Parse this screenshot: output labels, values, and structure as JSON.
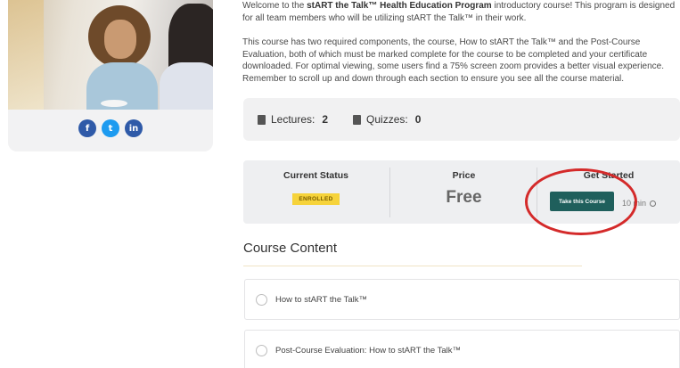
{
  "intro": {
    "p1_prefix": "Welcome to the ",
    "p1_bold": "stART the Talk™ Health Education Program",
    "p1_suffix": " introductory course! This program is designed for all team members who will be utilizing stART the Talk™ in their work.",
    "p2": "This course has two required components, the course, How to stART the Talk™ and the Post-Course Evaluation, both of which must be marked complete for the course to be completed and your certificate downloaded. For optimal viewing, some users find a 75% screen zoom provides a better visual experience. Remember to scroll up and down through each section to ensure you see all the course material."
  },
  "socials": [
    {
      "name": "facebook-icon",
      "glyph": "f"
    },
    {
      "name": "twitter-icon",
      "glyph": "t"
    },
    {
      "name": "linkedin-icon",
      "glyph": "in"
    }
  ],
  "stats": {
    "lectures_label": "Lectures:",
    "lectures_value": "2",
    "quizzes_label": "Quizzes:",
    "quizzes_value": "0"
  },
  "status": {
    "current_status_label": "Current Status",
    "badge": "ENROLLED",
    "price_label": "Price",
    "price_value": "Free",
    "get_started_label": "Get Started",
    "button": "Take this Course",
    "duration": "10 min"
  },
  "content": {
    "title": "Course Content",
    "lessons": [
      "How to stART the Talk™",
      "Post-Course Evaluation: How to stART the Talk™"
    ]
  },
  "colors": {
    "button": "#1f5f5c",
    "badge": "#f6d33b",
    "annotation": "#d42a2a"
  }
}
